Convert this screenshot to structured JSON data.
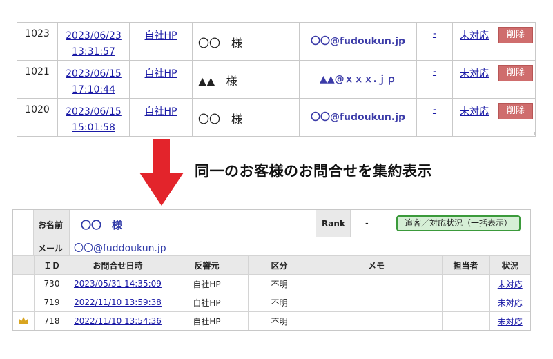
{
  "top_list": {
    "rows": [
      {
        "id": "1023",
        "date": "2023/06/23",
        "time": "13:31:57",
        "source": "自社HP",
        "name": "〇〇　様",
        "email": "〇〇@fudoukun.jp",
        "dash": "-",
        "status": "未対応",
        "delete": "削除"
      },
      {
        "id": "1021",
        "date": "2023/06/15",
        "time": "17:10:44",
        "source": "自社HP",
        "name": "▲▲　様",
        "email": "▲▲@ｘｘｘ.ｊｐ",
        "dash": "-",
        "status": "未対応",
        "delete": "削除"
      },
      {
        "id": "1020",
        "date": "2023/06/15",
        "time": "15:01:58",
        "source": "自社HP",
        "name": "〇〇　様",
        "email": "〇〇@fudoukun.jp",
        "dash": "-",
        "status": "未対応",
        "delete": "削除"
      }
    ]
  },
  "banner": {
    "text": "同一のお客様のお問合せを集約表示",
    "arrow_color": "#e3242b"
  },
  "panel": {
    "name_label": "お名前",
    "customer_name": "〇〇　様",
    "rank_label": "Rank",
    "rank_value": "-",
    "bulk_button": "追客／対応状況（一括表示）",
    "mail_label": "メール",
    "customer_email": "〇〇@fuddoukun.jp",
    "headers": [
      "ＩＤ",
      "お問合せ日時",
      "反響元",
      "区分",
      "メモ",
      "担当者",
      "状況"
    ],
    "rows": [
      {
        "crown": false,
        "id": "730",
        "datetime": "2023/05/31 14:35:09",
        "source": "自社HP",
        "category": "不明",
        "memo": "",
        "assignee": "",
        "status": "未対応"
      },
      {
        "crown": false,
        "id": "719",
        "datetime": "2022/11/10 13:59:38",
        "source": "自社HP",
        "category": "不明",
        "memo": "",
        "assignee": "",
        "status": "未対応"
      },
      {
        "crown": true,
        "id": "718",
        "datetime": "2022/11/10 13:54:36",
        "source": "自社HP",
        "category": "不明",
        "memo": "",
        "assignee": "",
        "status": "未対応"
      }
    ]
  },
  "colors": {
    "link": "#1a1aa6",
    "email": "#2f3aa8",
    "delete_button": "#cf6d6d",
    "bulk_button_border": "#3b9a3b",
    "crown": "#d9a520"
  }
}
